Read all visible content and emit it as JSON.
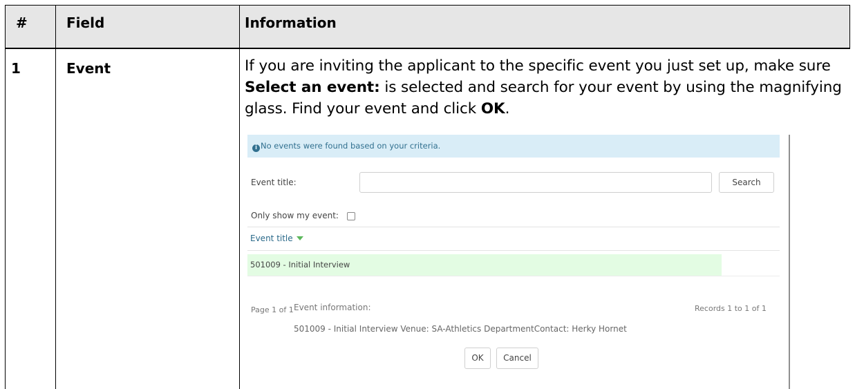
{
  "table": {
    "headers": [
      "#",
      "Field",
      "Information"
    ],
    "rows": [
      {
        "number": "1",
        "field": "Event",
        "info_parts": [
          {
            "text": "If you are inviting the applicant to the specific event you just set up, make sure ",
            "bold": false
          },
          {
            "text": "Select an event:",
            "bold": true
          },
          {
            "text": " is selected and search for your event by using the magnifying glass.  Find your event and click ",
            "bold": false
          },
          {
            "text": "OK",
            "bold": true
          },
          {
            "text": ".",
            "bold": false
          }
        ]
      }
    ]
  },
  "screenshot": {
    "alert_icon": "info-circle-icon",
    "alert_text": "No events were found based on your criteria.",
    "event_title_label": "Event title:",
    "event_title_value": "",
    "search_button": "Search",
    "only_my_event_label": "Only show my event:",
    "only_my_event_checked": false,
    "grid_column_header": "Event title",
    "sort_icon": "sort-desc-icon",
    "grid_rows": [
      "501009 - Initial Interview"
    ],
    "pager_text": "Page 1 of 1",
    "event_info_label": "Event information:",
    "records_text": "Records 1 to 1 of 1",
    "event_info_detail": "501009 - Initial Interview Venue: SA-Athletics DepartmentContact: Herky Hornet",
    "ok_button": "OK",
    "cancel_button": "Cancel"
  },
  "colors": {
    "header_bg": "#e6e6e6",
    "alert_bg": "#d9edf7",
    "selected_row_bg": "#e3fce3",
    "sort_arrow": "#5cb85c"
  }
}
